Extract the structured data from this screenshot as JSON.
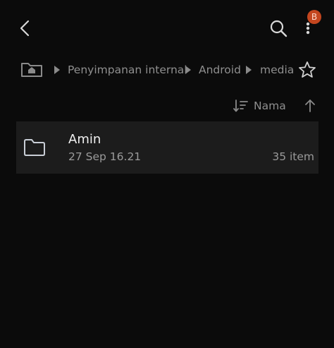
{
  "toolbar": {
    "back_icon": "chevron-left-icon",
    "search_icon": "search-icon",
    "more_icon": "more-vertical-icon",
    "badge_text": "B",
    "badge_color": "#c4461f"
  },
  "breadcrumb": {
    "home_icon": "home-folder-icon",
    "items": [
      {
        "label": "Penyimpanan internal"
      },
      {
        "label": "Android"
      },
      {
        "label": "media"
      }
    ],
    "favorite_icon": "star-outline-icon"
  },
  "sort": {
    "label": "Nama",
    "sort_icon": "sort-lines-icon",
    "direction_icon": "arrow-up-icon"
  },
  "files": [
    {
      "name": "Amin",
      "date": "27 Sep 16.21",
      "count": "35 item",
      "icon": "folder-icon"
    }
  ],
  "colors": {
    "background": "#0b0b0b",
    "row_background": "#1c1c1c",
    "secondary_text": "#8f8f8f"
  }
}
